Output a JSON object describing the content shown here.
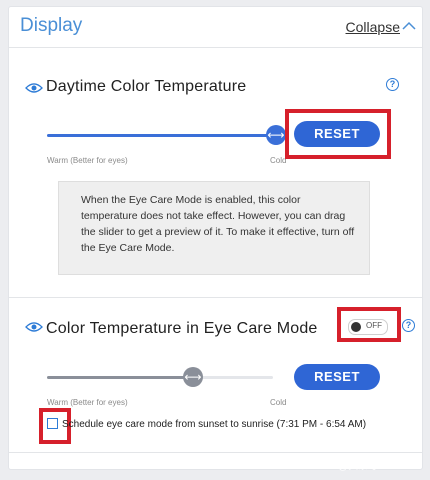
{
  "header": {
    "title": "Display",
    "collapse_label": "Collapse"
  },
  "daytime": {
    "title": "Daytime Color Temperature",
    "help": "?",
    "reset_label": "RESET",
    "warm_label": "Warm (Better for eyes)",
    "cold_label": "Cold",
    "slider_value": 1.0,
    "info_text": "When the Eye Care Mode is enabled, this color temperature does not take effect. However, you can drag the slider to get a preview of it. To make it effective, turn off the Eye Care Mode."
  },
  "eyecare": {
    "title": "Color Temperature in Eye Care Mode",
    "help": "?",
    "toggle_label": "OFF",
    "toggle_on": false,
    "reset_label": "RESET",
    "warm_label": "Warm (Better for eyes)",
    "cold_label": "Cold",
    "slider_value": 0.63,
    "schedule_label": "Schedule eye care mode from sunset to sunrise (7:31 PM - 6:54 AM)",
    "schedule_checked": false
  },
  "watermark": "@头条号",
  "colors": {
    "accent": "#2f66d5",
    "title_blue": "#4a8fd6",
    "highlight_red": "#d6202b",
    "disabled_slider": "#8a8f99"
  },
  "icons": [
    "eye-icon",
    "help-icon",
    "chevron-up-icon",
    "slider-arrows-icon"
  ]
}
